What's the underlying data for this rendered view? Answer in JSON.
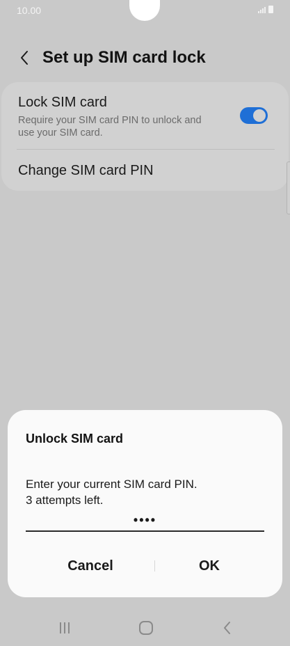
{
  "status_bar": {
    "time": "10.00",
    "icons": [
      "signal-icon",
      "battery-icon"
    ]
  },
  "header": {
    "back_icon": "chevron-left-icon",
    "title": "Set up SIM card lock"
  },
  "settings": {
    "lock_sim": {
      "title": "Lock SIM card",
      "description": "Require your SIM card PIN to unlock and use your SIM card.",
      "enabled": true
    },
    "change_pin": {
      "title": "Change SIM card PIN"
    }
  },
  "dialog": {
    "title": "Unlock SIM card",
    "message_line1": "Enter your current SIM card PIN.",
    "message_line2": "3 attempts left.",
    "pin_value": "••••",
    "cancel_label": "Cancel",
    "ok_label": "OK"
  },
  "nav_bar": {
    "icons": [
      "recent-apps-icon",
      "home-icon",
      "back-icon"
    ]
  },
  "colors": {
    "background": "#c9c9c9",
    "accent": "#1f6fd6",
    "dialog": "#fafafa"
  }
}
